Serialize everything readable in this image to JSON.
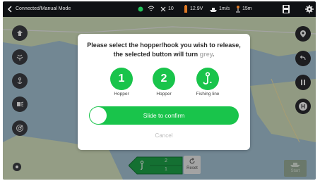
{
  "statusbar": {
    "mode": "Connected/Manual Mode",
    "satellites": "10",
    "voltage": "12.9V",
    "speed": "1m/s",
    "distance": "15m"
  },
  "dialog": {
    "message_part1": "Please select the hopper/hook you wish to release, the selected button will turn ",
    "message_grey": "grey",
    "message_end": ".",
    "options": [
      {
        "value": "1",
        "label": "Hopper"
      },
      {
        "value": "2",
        "label": "Hopper"
      },
      {
        "value": "",
        "label": "Fishing line"
      }
    ],
    "slide_label": "Slide to confirm",
    "cancel_label": "Cancel"
  },
  "bottom": {
    "hook_top": "2",
    "hook_bottom": "1",
    "reset_label": "Reset",
    "start_label": "Start"
  },
  "colors": {
    "accent_green": "#19c44b",
    "status_dot": "#22c35a"
  },
  "icons": [
    "back-icon",
    "gps-status-icon",
    "wifi-icon",
    "satellite-icon",
    "battery-icon",
    "boat-speed-icon",
    "distance-icon",
    "save-icon",
    "gear-icon",
    "home-icon",
    "sonar-icon",
    "anchor-icon",
    "lights-icon",
    "radar-icon",
    "location-pin-icon",
    "return-icon",
    "pause-icon",
    "h-icon",
    "target-icon",
    "hook-icon",
    "reset-icon",
    "boat-icon"
  ]
}
